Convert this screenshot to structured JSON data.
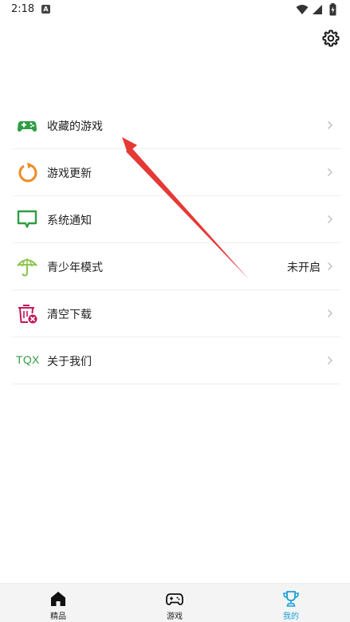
{
  "status_bar": {
    "time": "2:18",
    "notification_icon": "A"
  },
  "header": {
    "settings_icon": "gear-icon"
  },
  "menu": {
    "items": [
      {
        "label": "收藏的游戏",
        "value": "",
        "icon": "gamepad-icon",
        "color": "#2f9e44"
      },
      {
        "label": "游戏更新",
        "value": "",
        "icon": "refresh-icon",
        "color": "#f08a24"
      },
      {
        "label": "系统通知",
        "value": "",
        "icon": "message-icon",
        "color": "#2f9e44"
      },
      {
        "label": "青少年模式",
        "value": "未开启",
        "icon": "umbrella-icon",
        "color": "#8bc34a"
      },
      {
        "label": "清空下载",
        "value": "",
        "icon": "trash-icon",
        "color": "#c2185b"
      },
      {
        "label": "关于我们",
        "value": "",
        "icon": "tqx-logo",
        "logo_text": "TQX",
        "color": "#2f9e44"
      }
    ]
  },
  "tabbar": {
    "tabs": [
      {
        "label": "精品",
        "icon": "home-icon",
        "active": false
      },
      {
        "label": "游戏",
        "icon": "controller-icon",
        "active": false
      },
      {
        "label": "我的",
        "icon": "trophy-icon",
        "active": true
      }
    ],
    "active_color": "#1aa0d8"
  },
  "annotation": {
    "arrow_color": "#e53935"
  }
}
